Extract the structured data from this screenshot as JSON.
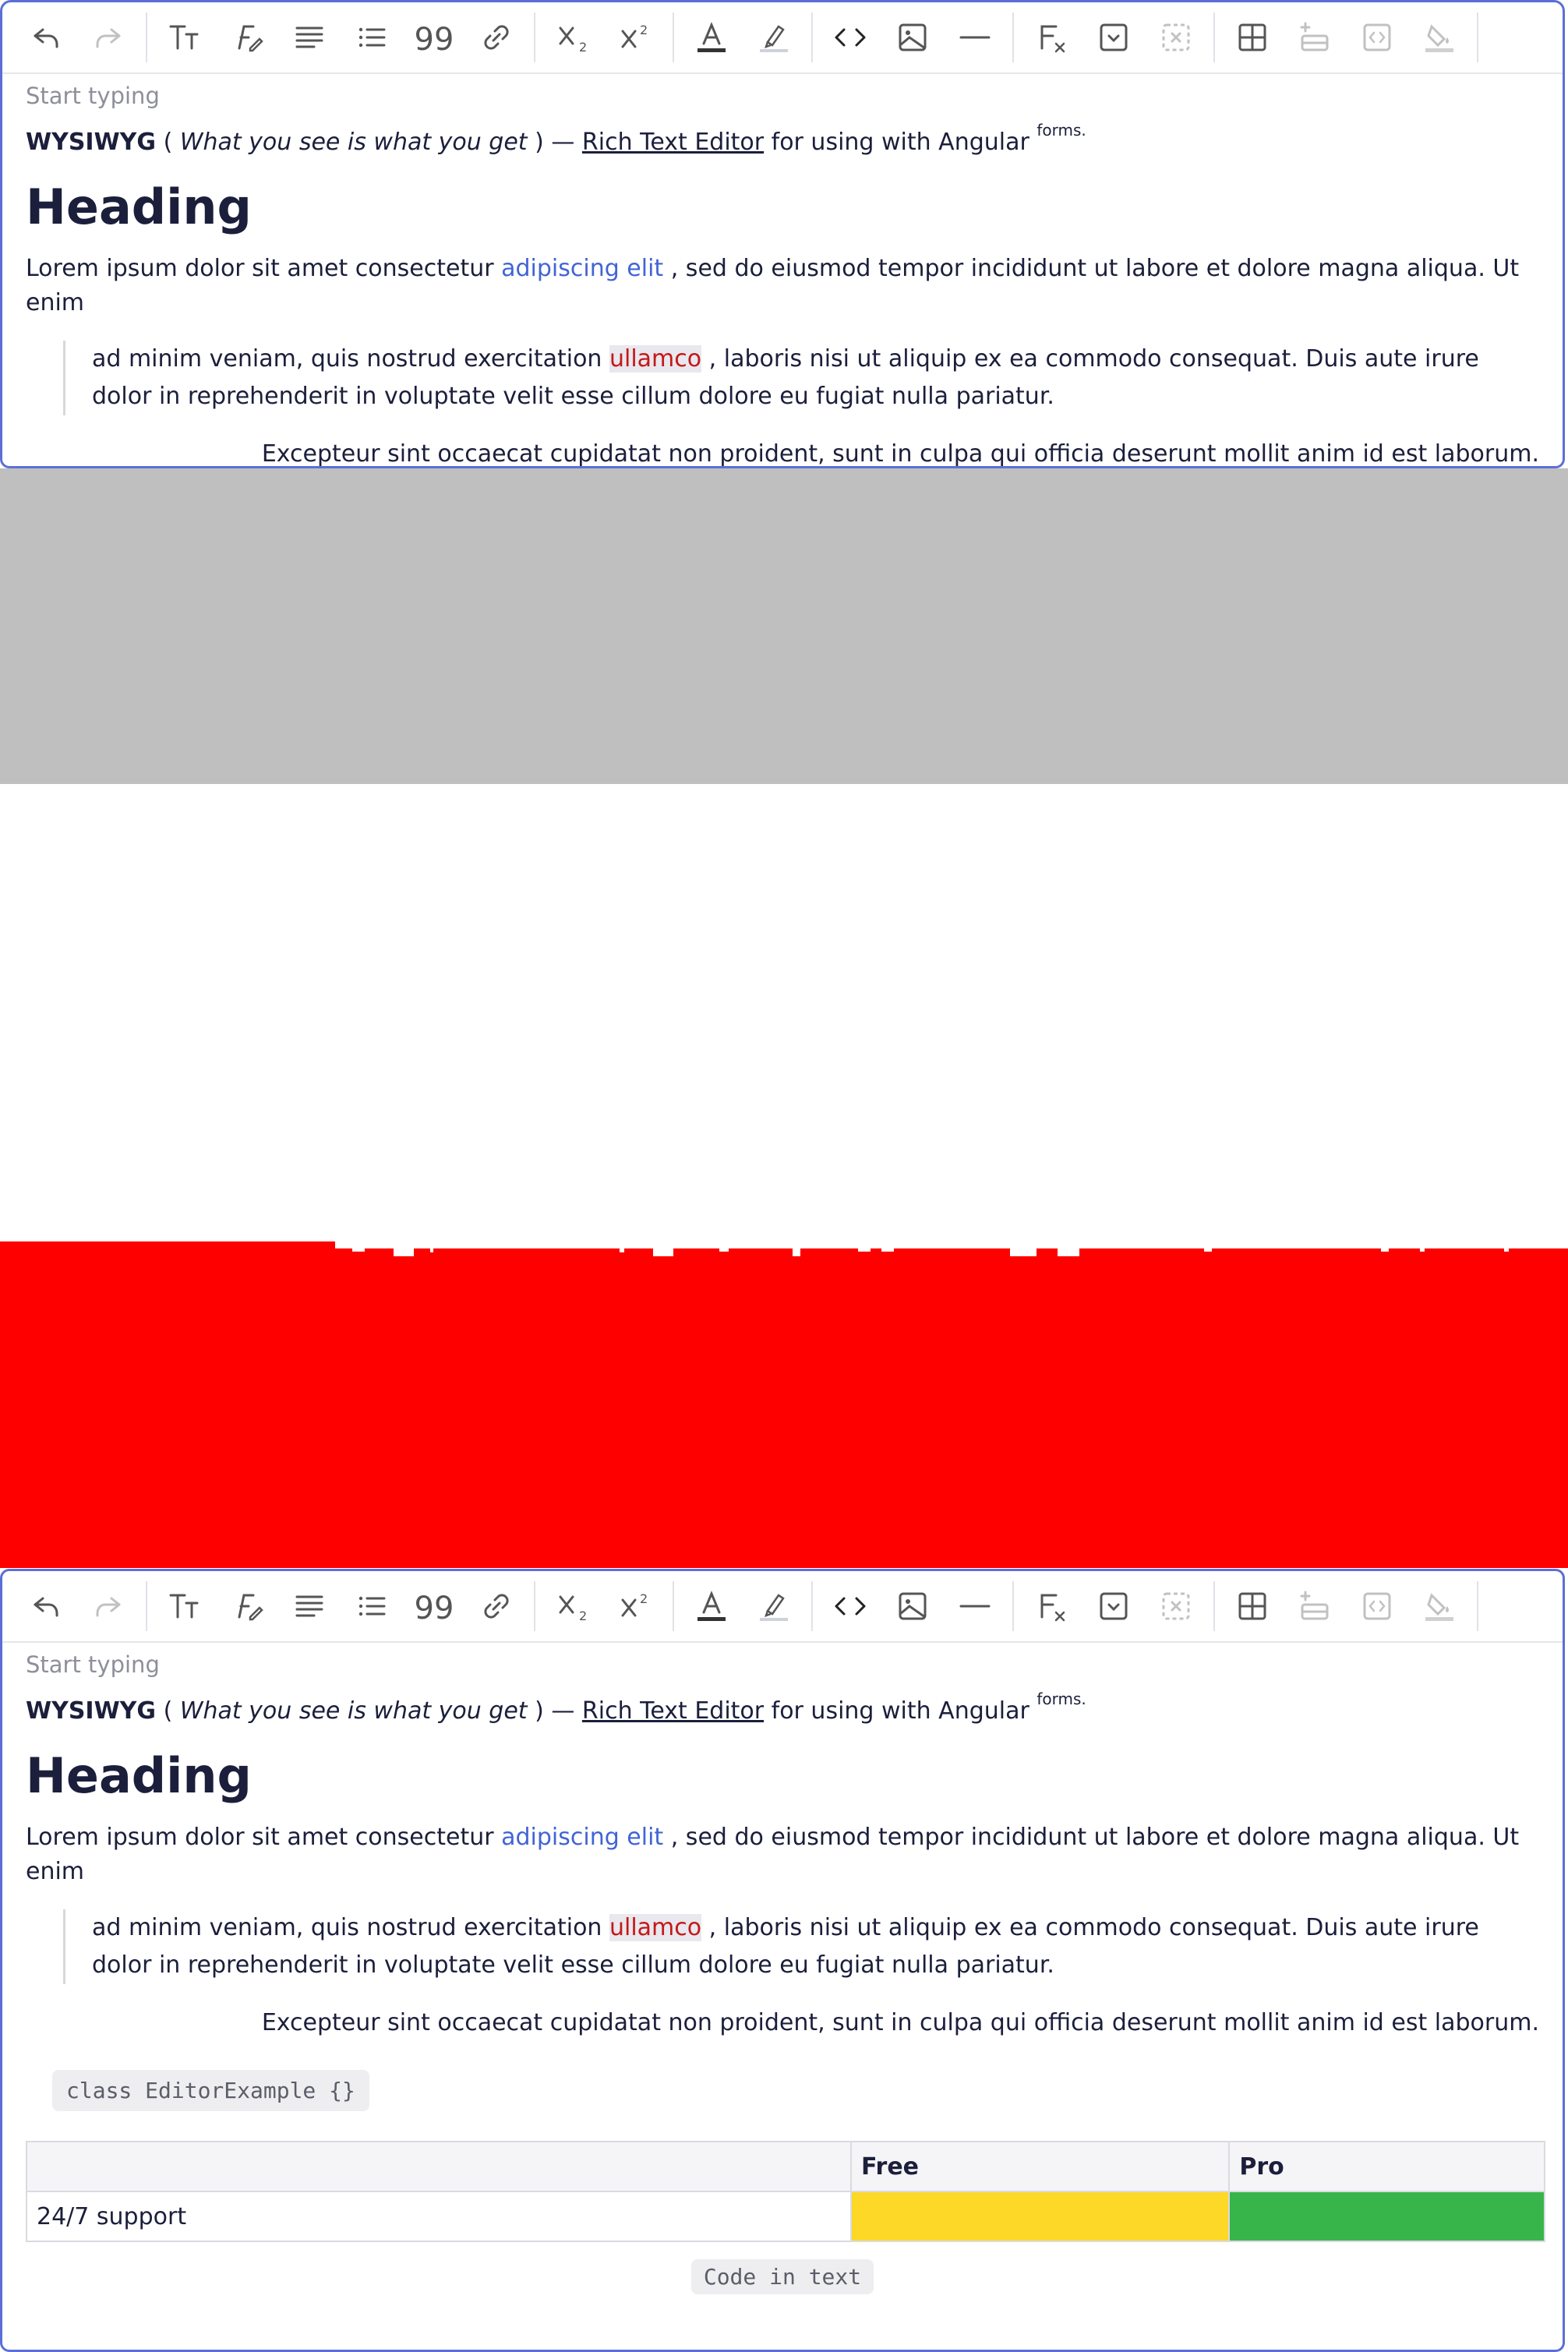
{
  "toolbar": {
    "items": [
      {
        "name": "undo-icon",
        "enabled": true
      },
      {
        "name": "redo-icon",
        "enabled": false
      },
      {
        "name": "font-size-icon",
        "enabled": true
      },
      {
        "name": "font-style-icon",
        "enabled": true
      },
      {
        "name": "align-icon",
        "enabled": true
      },
      {
        "name": "list-icon",
        "enabled": true
      },
      {
        "name": "quote-icon",
        "enabled": true
      },
      {
        "name": "link-icon",
        "enabled": true
      },
      {
        "name": "subscript-icon",
        "enabled": true
      },
      {
        "name": "superscript-icon",
        "enabled": true
      },
      {
        "name": "text-color-icon",
        "enabled": true
      },
      {
        "name": "highlight-icon",
        "enabled": true
      },
      {
        "name": "code-icon",
        "enabled": true
      },
      {
        "name": "image-icon",
        "enabled": true
      },
      {
        "name": "horizontal-rule-icon",
        "enabled": true
      },
      {
        "name": "clear-format-icon",
        "enabled": true
      },
      {
        "name": "insert-details-icon",
        "enabled": true
      },
      {
        "name": "remove-details-icon",
        "enabled": false
      },
      {
        "name": "table-icon",
        "enabled": true
      },
      {
        "name": "row-insert-icon",
        "enabled": false
      },
      {
        "name": "embed-icon",
        "enabled": false
      },
      {
        "name": "cell-fill-icon",
        "enabled": false
      }
    ]
  },
  "editor": {
    "placeholder": "Start typing",
    "line1": {
      "bold": "WYSIWYG",
      "open_paren": " ( ",
      "italic": "What you see is what you get",
      "close_paren": " ) — ",
      "underline": "Rich Text Editor",
      "rest": " for using with Angular ",
      "sup": "forms."
    },
    "heading": "Heading",
    "para": {
      "start": "Lorem ipsum dolor sit amet consectetur ",
      "link": "adipiscing elit",
      "end": " , sed do eiusmod tempor incididunt ut labore et dolore magna aliqua. Ut enim"
    },
    "quote": {
      "start": "ad minim veniam, quis nostrud exercitation ",
      "highlight": "ullamco",
      "end": " , laboris nisi ut aliquip ex ea commodo consequat. Duis aute irure dolor in reprehenderit in voluptate velit esse cillum dolore eu fugiat nulla pariatur."
    },
    "right_para": "Excepteur sint occaecat cupidatat non proident, sunt in culpa qui officia deserunt mollit anim id est laborum.",
    "code_block": "class EditorExample {}",
    "table": {
      "headers": [
        "",
        "Free",
        "Pro"
      ],
      "row": [
        "24/7 support",
        "",
        ""
      ]
    },
    "inline_code": "Code in text"
  },
  "colors": {
    "border": "#5c6fd6",
    "link": "#4164d6",
    "highlight_text": "#c41818",
    "gray_band": "#bfbfbf",
    "red_band": "#ff0000",
    "yellow_cell": "#fdd826",
    "green_cell": "#38b54a"
  }
}
